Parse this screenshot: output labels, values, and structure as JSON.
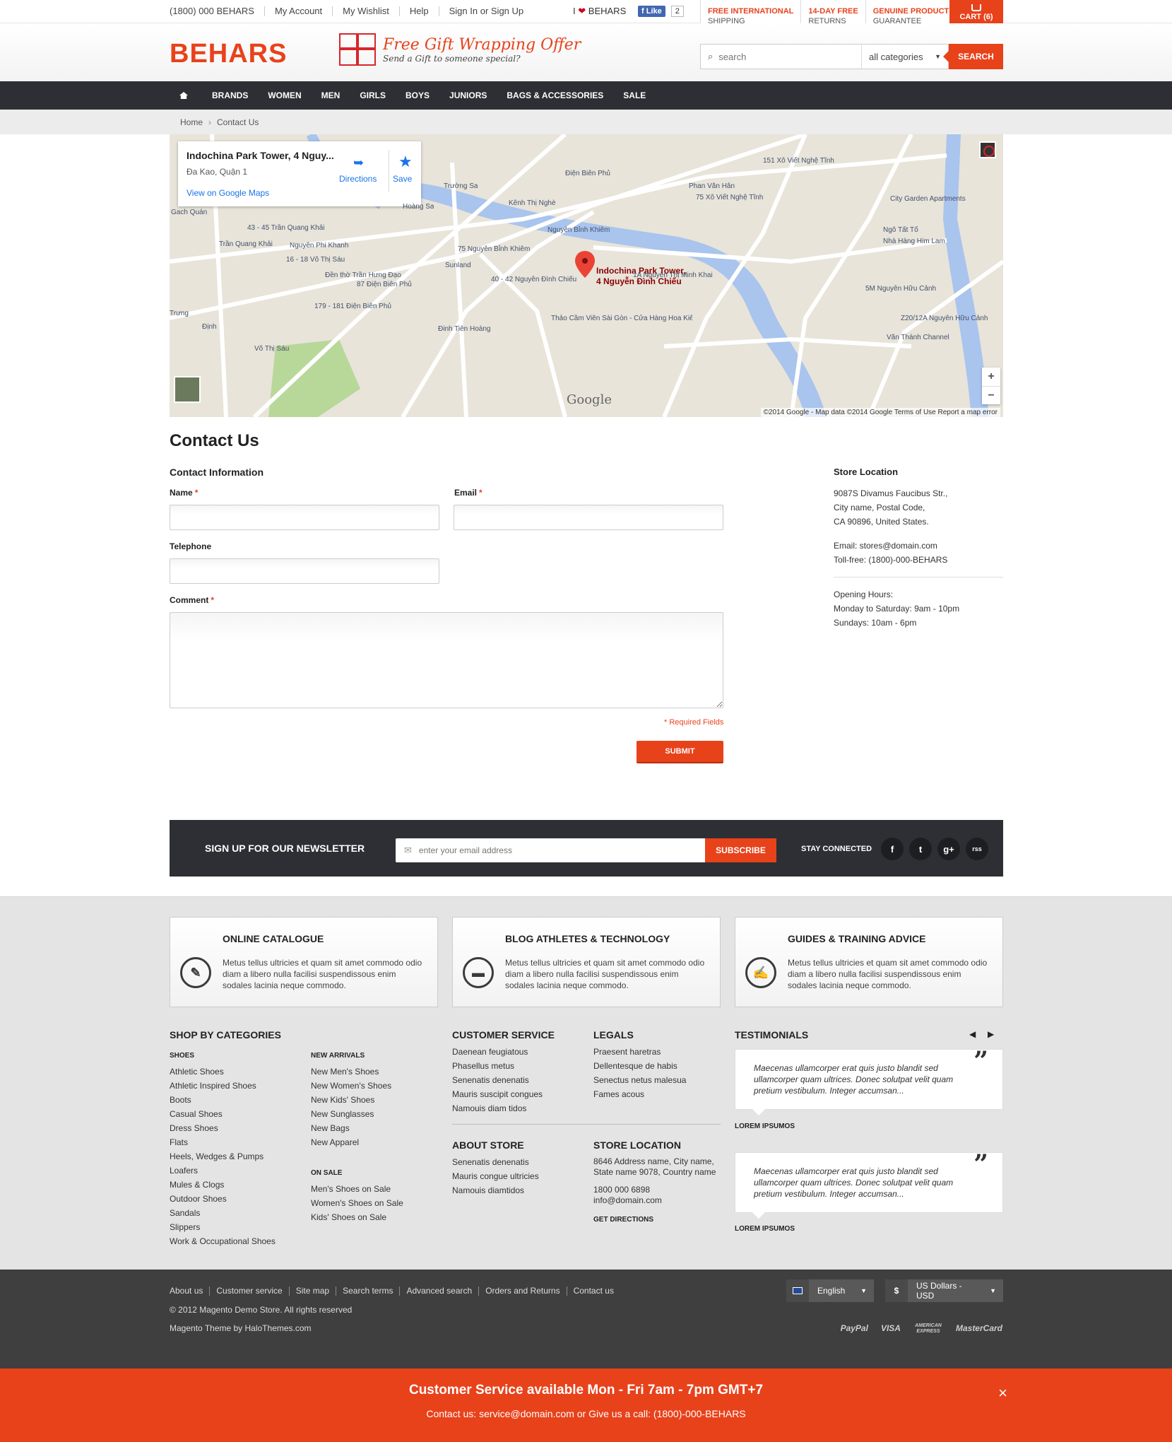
{
  "topbar": {
    "links": [
      "(1800) 000 BEHARS",
      "My Account",
      "My Wishlist",
      "Help",
      "Sign In or Sign Up"
    ],
    "ilove_prefix": "I",
    "ilove_brand": "BEHARS",
    "fb_like": "Like",
    "fb_count": "2",
    "perks": [
      {
        "line1": "FREE INTERNATIONAL",
        "line2": "SHIPPING"
      },
      {
        "line1": "14-DAY FREE",
        "line2": "RETURNS"
      },
      {
        "line1": "GENUINE PRODUCT",
        "line2": "GUARANTEE"
      }
    ],
    "cart_label": "CART (6)"
  },
  "header": {
    "logo": "BEHARS",
    "gift_title": "Free Gift Wrapping Offer",
    "gift_sub": "Send a Gift to someone special?",
    "search_placeholder": "search",
    "category_value": "all categories",
    "search_button": "SEARCH"
  },
  "nav": {
    "items": [
      "BRANDS",
      "WOMEN",
      "MEN",
      "GIRLS",
      "BOYS",
      "JUNIORS",
      "BAGS & ACCESSORIES",
      "SALE"
    ]
  },
  "breadcrumb": {
    "home": "Home",
    "current": "Contact Us"
  },
  "map": {
    "place_title": "Indochina Park Tower, 4 Nguy...",
    "place_sub": "Đa Kao, Quận 1",
    "view_link": "View on Google Maps",
    "directions": "Directions",
    "save": "Save",
    "pin_label_1": "Indochina Park Tower,",
    "pin_label_2": "4 Nguyễn Đình Chiểu",
    "google": "Google",
    "copyright": "©2014 Google - Map data ©2014 Google   Terms of Use   Report a map error",
    "zoom_in": "+",
    "zoom_out": "−",
    "street_labels": [
      "Trường Sa",
      "Hoàng Sa",
      "Kênh Thị Nghè",
      "Điện Biên Phủ",
      "Phan Văn Hân",
      "151 Xô Viết Nghệ Tĩnh",
      "75 Xô Viết Nghệ Tĩnh",
      "City Garden Apartments",
      "Ngô Tất Tố",
      "Nhà Hàng Him Lam",
      "43 - 45 Trần Quang Khải",
      "Trần Quang Khải",
      "Nguyễn Phi Khanh",
      "16 - 18 Võ Thị Sáu",
      "75 Nguyễn Bỉnh Khiêm",
      "Sunland",
      "Đền thờ Trần Hưng Đạo",
      "87 Điện Biên Phủ",
      "40 - 42 Nguyễn Đình Chiểu",
      "1A Nguyễn Thị Minh Khai",
      "179 - 181 Điện Biên Phủ",
      "5M Nguyễn Hữu Cảnh",
      "Z20/12A Nguyễn Hữu Cảnh",
      "Văn Thánh Channel",
      "Thảo Cầm Viên Sài Gòn - Cửa Hàng Hoa Kiếng",
      "Võ Thị Sáu",
      "Nguyễn Bỉnh Khiêm",
      "Đinh Tiên Hoàng",
      "Gach Quán",
      "Trưng",
      "Định"
    ]
  },
  "contact": {
    "title": "Contact Us",
    "section": "Contact Information",
    "name_label": "Name",
    "email_label": "Email",
    "telephone_label": "Telephone",
    "comment_label": "Comment",
    "required_mark": "*",
    "required_note": "* Required Fields",
    "submit": "SUBMIT"
  },
  "store": {
    "title": "Store Location",
    "address": [
      "9087S Divamus Faucibus Str.,",
      "City name, Postal Code,",
      "CA 90896, United States."
    ],
    "email": "Email: stores@domain.com",
    "tollfree": "Toll-free: (1800)-000-BEHARS",
    "hours_title": "Opening Hours:",
    "hours": [
      "Monday to Saturday: 9am - 10pm",
      "Sundays: 10am - 6pm"
    ]
  },
  "newsletter": {
    "title": "SIGN UP FOR OUR NEWSLETTER",
    "placeholder": "enter your email address",
    "button": "SUBSCRIBE",
    "stay": "STAY CONNECTED",
    "social": [
      "f",
      "t",
      "g+",
      "rss"
    ]
  },
  "features": [
    {
      "title": "ONLINE CATALOGUE",
      "desc": "Metus tellus ultricies et quam sit amet commodo odio diam a libero nulla facilisi suspendissous enim sodales lacinia neque commodo."
    },
    {
      "title": "BLOG ATHLETES & TECHNOLOGY",
      "desc": "Metus tellus ultricies et quam sit amet commodo odio diam a libero nulla facilisi suspendissous enim sodales lacinia neque commodo."
    },
    {
      "title": "GUIDES & TRAINING ADVICE",
      "desc": "Metus tellus ultricies et quam sit amet commodo odio diam a libero nulla facilisi suspendissous enim sodales lacinia neque commodo."
    }
  ],
  "footer": {
    "shop_title": "SHOP BY CATEGORIES",
    "shoes_title": "SHOES",
    "shoes": [
      "Athletic Shoes",
      "Athletic Inspired Shoes",
      "Boots",
      "Casual Shoes",
      "Dress Shoes",
      "Flats",
      "Heels, Wedges & Pumps",
      "Loafers",
      "Mules & Clogs",
      "Outdoor Shoes",
      "Sandals",
      "Slippers",
      "Work & Occupational Shoes"
    ],
    "arrivals_title": "NEW ARRIVALS",
    "arrivals": [
      "New Men's Shoes",
      "New Women's Shoes",
      "New Kids' Shoes",
      "New Sunglasses",
      "New Bags",
      "New Apparel"
    ],
    "sale_title": "ON SALE",
    "sale": [
      "Men's Shoes on Sale",
      "Women's Shoes on Sale",
      "Kids' Shoes on Sale"
    ],
    "cs_title": "CUSTOMER SERVICE",
    "cs": [
      "Daenean feugiatous",
      "Phasellus metus",
      "Senenatis denenatis",
      "Mauris suscipit congues",
      "Namouis diam tidos"
    ],
    "legals_title": "LEGALS",
    "legals": [
      "Praesent haretras",
      "Dellentesque de habis",
      "Senectus netus malesua",
      "Fames acous"
    ],
    "about_title": "ABOUT STORE",
    "about": [
      "Senenatis denenatis",
      "Mauris congue ultricies",
      "Namouis diamtidos"
    ],
    "loc_title": "STORE LOCATION",
    "loc_address": [
      "8646 Address name, City name,",
      "State name 9078, Country name"
    ],
    "loc_contact": [
      "1800 000 6898",
      "info@domain.com"
    ],
    "get_directions": "GET DIRECTIONS",
    "testimonials_title": "TESTIMONIALS",
    "testimonials": [
      {
        "text": "Maecenas ullamcorper erat quis justo blandit sed ullamcorper quam ultrices. Donec solutpat velit quam pretium vestibulum. Integer accumsan...",
        "author": "LOREM IPSUMOS"
      },
      {
        "text": "Maecenas ullamcorper erat quis justo blandit sed ullamcorper quam ultrices. Donec solutpat velit quam pretium vestibulum. Integer accumsan...",
        "author": "LOREM IPSUMOS"
      }
    ]
  },
  "bottom": {
    "links": [
      "About us",
      "Customer service",
      "Site map",
      "Search terms",
      "Advanced search",
      "Orders and Returns",
      "Contact us"
    ],
    "copyright": "© 2012 Magento Demo Store. All rights reserved",
    "theme_by": "Magento Theme by HaloThemes.com",
    "language": "English",
    "currency_symbol": "$",
    "currency": "US Dollars - USD",
    "payments": [
      "PayPal",
      "VISA",
      "AMERICAN EXPRESS",
      "MasterCard"
    ]
  },
  "cs_banner": {
    "title": "Customer Service available Mon - Fri 7am - 7pm GMT+7",
    "sub": "Contact us: service@domain.com or Give us a call: (1800)-000-BEHARS",
    "close": "×"
  },
  "colors": {
    "accent": "#e8421b",
    "nav_bg": "#2d2f34",
    "footer_bg": "#e4e4e4",
    "bottom_bg": "#3f3f3f"
  }
}
